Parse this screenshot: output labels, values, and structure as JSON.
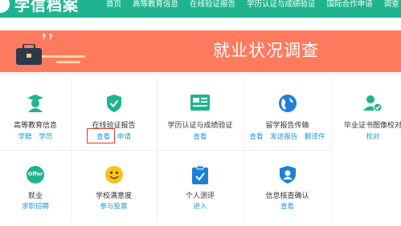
{
  "header": {
    "logo_text": "学信档案",
    "nav": [
      "首页",
      "高等教育信息",
      "在线验证报告",
      "学历认证与成绩验证",
      "国际合作申请",
      "调查"
    ]
  },
  "banner": {
    "title": "就业状况调查",
    "qmarks": "? ?"
  },
  "colors": {
    "brand_green": "#1fb48f",
    "banner_orange": "#ff7a5e",
    "link_blue": "#1f9ad6",
    "highlight_red": "#e03a2f"
  },
  "grid": {
    "row1": [
      {
        "title": "高等教育信息",
        "links": [
          "学籍",
          "学历"
        ],
        "icon": "graduate-icon"
      },
      {
        "title": "在线验证报告",
        "links": [
          "查看",
          "申请"
        ],
        "icon": "shield-check-icon"
      },
      {
        "title": "学历认证与成绩验证",
        "links": [
          "查看"
        ],
        "icon": "id-card-icon"
      },
      {
        "title": "留学报告传输",
        "links": [
          "查看",
          "发送报告",
          "翻译件"
        ],
        "icon": "globe-icon"
      },
      {
        "title": "毕业证书图像校对",
        "links": [
          "校对"
        ],
        "icon": "user-check-icon"
      }
    ],
    "row2": [
      {
        "title": "就业",
        "links": [
          "求职招聘"
        ],
        "icon": "offer-icon",
        "icon_text": "Offer"
      },
      {
        "title": "学校满意度",
        "links": [
          "参与投票"
        ],
        "icon": "smiley-icon"
      },
      {
        "title": "个人测评",
        "links": [
          "进入"
        ],
        "icon": "clipboard-check-icon"
      },
      {
        "title": "信息核查确认",
        "links": [
          "查看"
        ],
        "icon": "user-badge-icon"
      }
    ]
  }
}
